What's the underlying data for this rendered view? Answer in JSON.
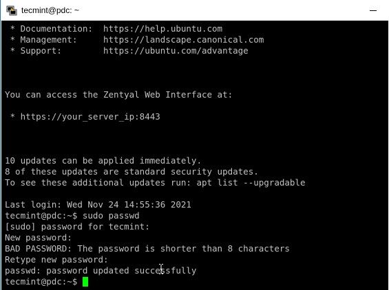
{
  "window": {
    "title": "tecmint@pdc: ~",
    "icon": "putty-terminal-icon",
    "controls": [
      "minimize"
    ]
  },
  "terminal": {
    "lines": [
      " * Documentation:  https://help.ubuntu.com",
      " * Management:     https://landscape.canonical.com",
      " * Support:        https://ubuntu.com/advantage",
      "",
      "",
      "",
      "You can access the Zentyal Web Interface at:",
      "",
      " * https://your_server_ip:8443",
      "",
      "",
      "",
      "10 updates can be applied immediately.",
      "8 of these updates are standard security updates.",
      "To see these additional updates run: apt list --upgradable",
      "",
      "Last login: Wed Nov 24 14:55:36 2021",
      "tecmint@pdc:~$ sudo passwd",
      "[sudo] password for tecmint:",
      "New password:",
      "BAD PASSWORD: The password is shorter than 8 characters",
      "Retype new password:",
      "passwd: password updated successfully"
    ],
    "prompt": "tecmint@pdc:~$ ",
    "cursor_color": "#00ff00",
    "text_color": "#c0c0c0",
    "background_color": "#000000"
  }
}
